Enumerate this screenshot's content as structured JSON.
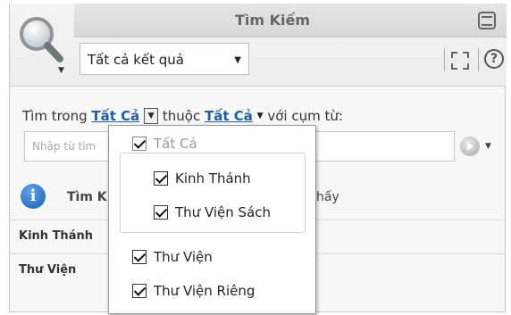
{
  "header": {
    "title": "Tìm Kiếm",
    "scope_select_value": "Tất cả kết quả"
  },
  "search_row": {
    "prefix": "Tìm trong",
    "scope_link": "Tất Cả",
    "middle": "thuộc",
    "collection_link": "Tất Cả",
    "suffix": "với cụm từ:"
  },
  "phrase_input": {
    "placeholder": "Nhập từ tìm"
  },
  "results": {
    "header_text": "Tìm K",
    "header_tail": "hấy",
    "rows": [
      {
        "label": "Kinh Thánh"
      },
      {
        "label": "Thư Viện"
      }
    ]
  },
  "menu": {
    "all": {
      "label": "Tất Cả",
      "checked": true,
      "disabled": true
    },
    "bible": {
      "label": "Kinh Thánh",
      "checked": true
    },
    "book_library": {
      "label": "Thư Viện Sách",
      "checked": true
    },
    "library": {
      "label": "Thư Viện",
      "checked": true
    },
    "private_library": {
      "label": "Thư Viện Riêng",
      "checked": true
    }
  },
  "icons": {
    "search": "magnifier-icon",
    "restore": "restore-window-icon",
    "expand": "fullscreen-icon",
    "help": "help-icon",
    "go": "go-arrow-icon",
    "info": "info-icon"
  }
}
